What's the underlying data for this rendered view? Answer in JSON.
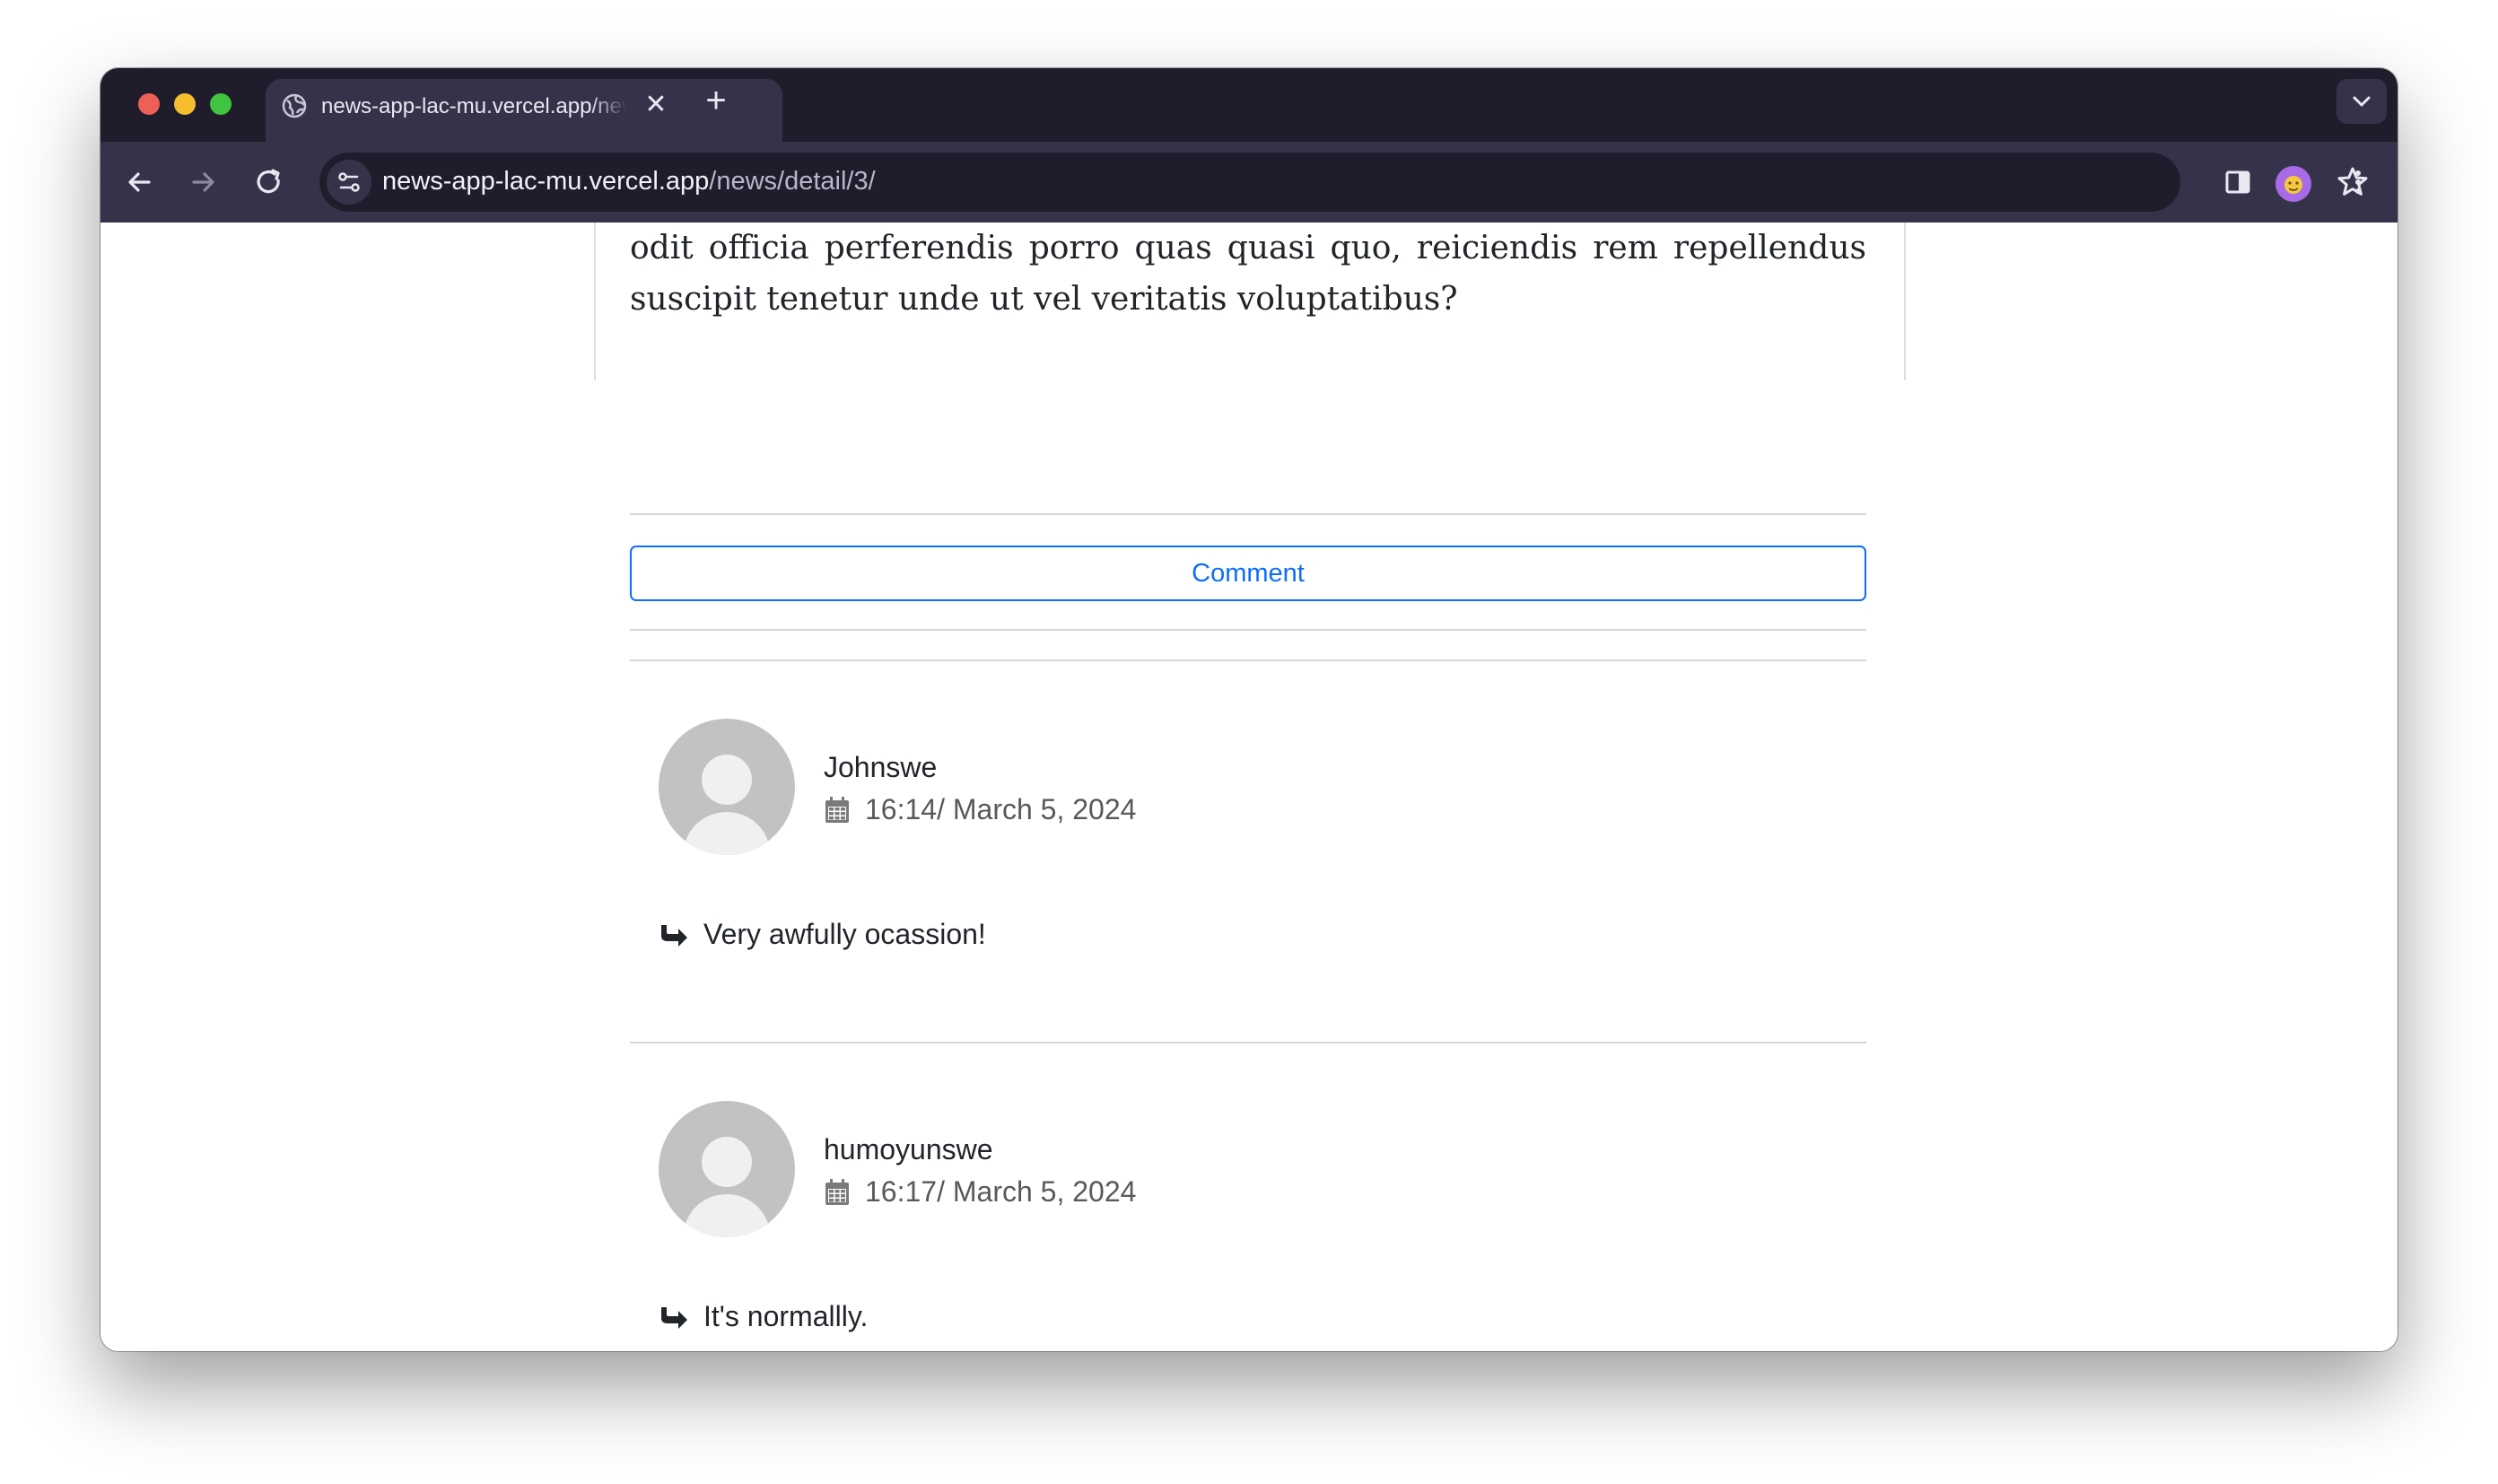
{
  "browser": {
    "tab": {
      "title": "news-app-lac-mu.vercel.app/news/detail/3/"
    },
    "address": {
      "host": "news-app-lac-mu.vercel.app",
      "path": "/news/detail/3/"
    }
  },
  "article": {
    "text_tail": "odit officia perferendis porro quas quasi quo, reiciendis rem repellendus suscipit tenetur unde ut vel veritatis voluptatibus?"
  },
  "comment_button": {
    "label": "Comment"
  },
  "comments": [
    {
      "author": "Johnswe",
      "date": "16:14/ March 5, 2024",
      "text": "Very awfully ocassion!"
    },
    {
      "author": "humoyunswe",
      "date": "16:17/ March 5, 2024",
      "text": "It's normallly."
    }
  ],
  "colors": {
    "accent": "#0d6efd",
    "tabstrip": "#1f1d2c",
    "toolbar": "#35334a"
  }
}
